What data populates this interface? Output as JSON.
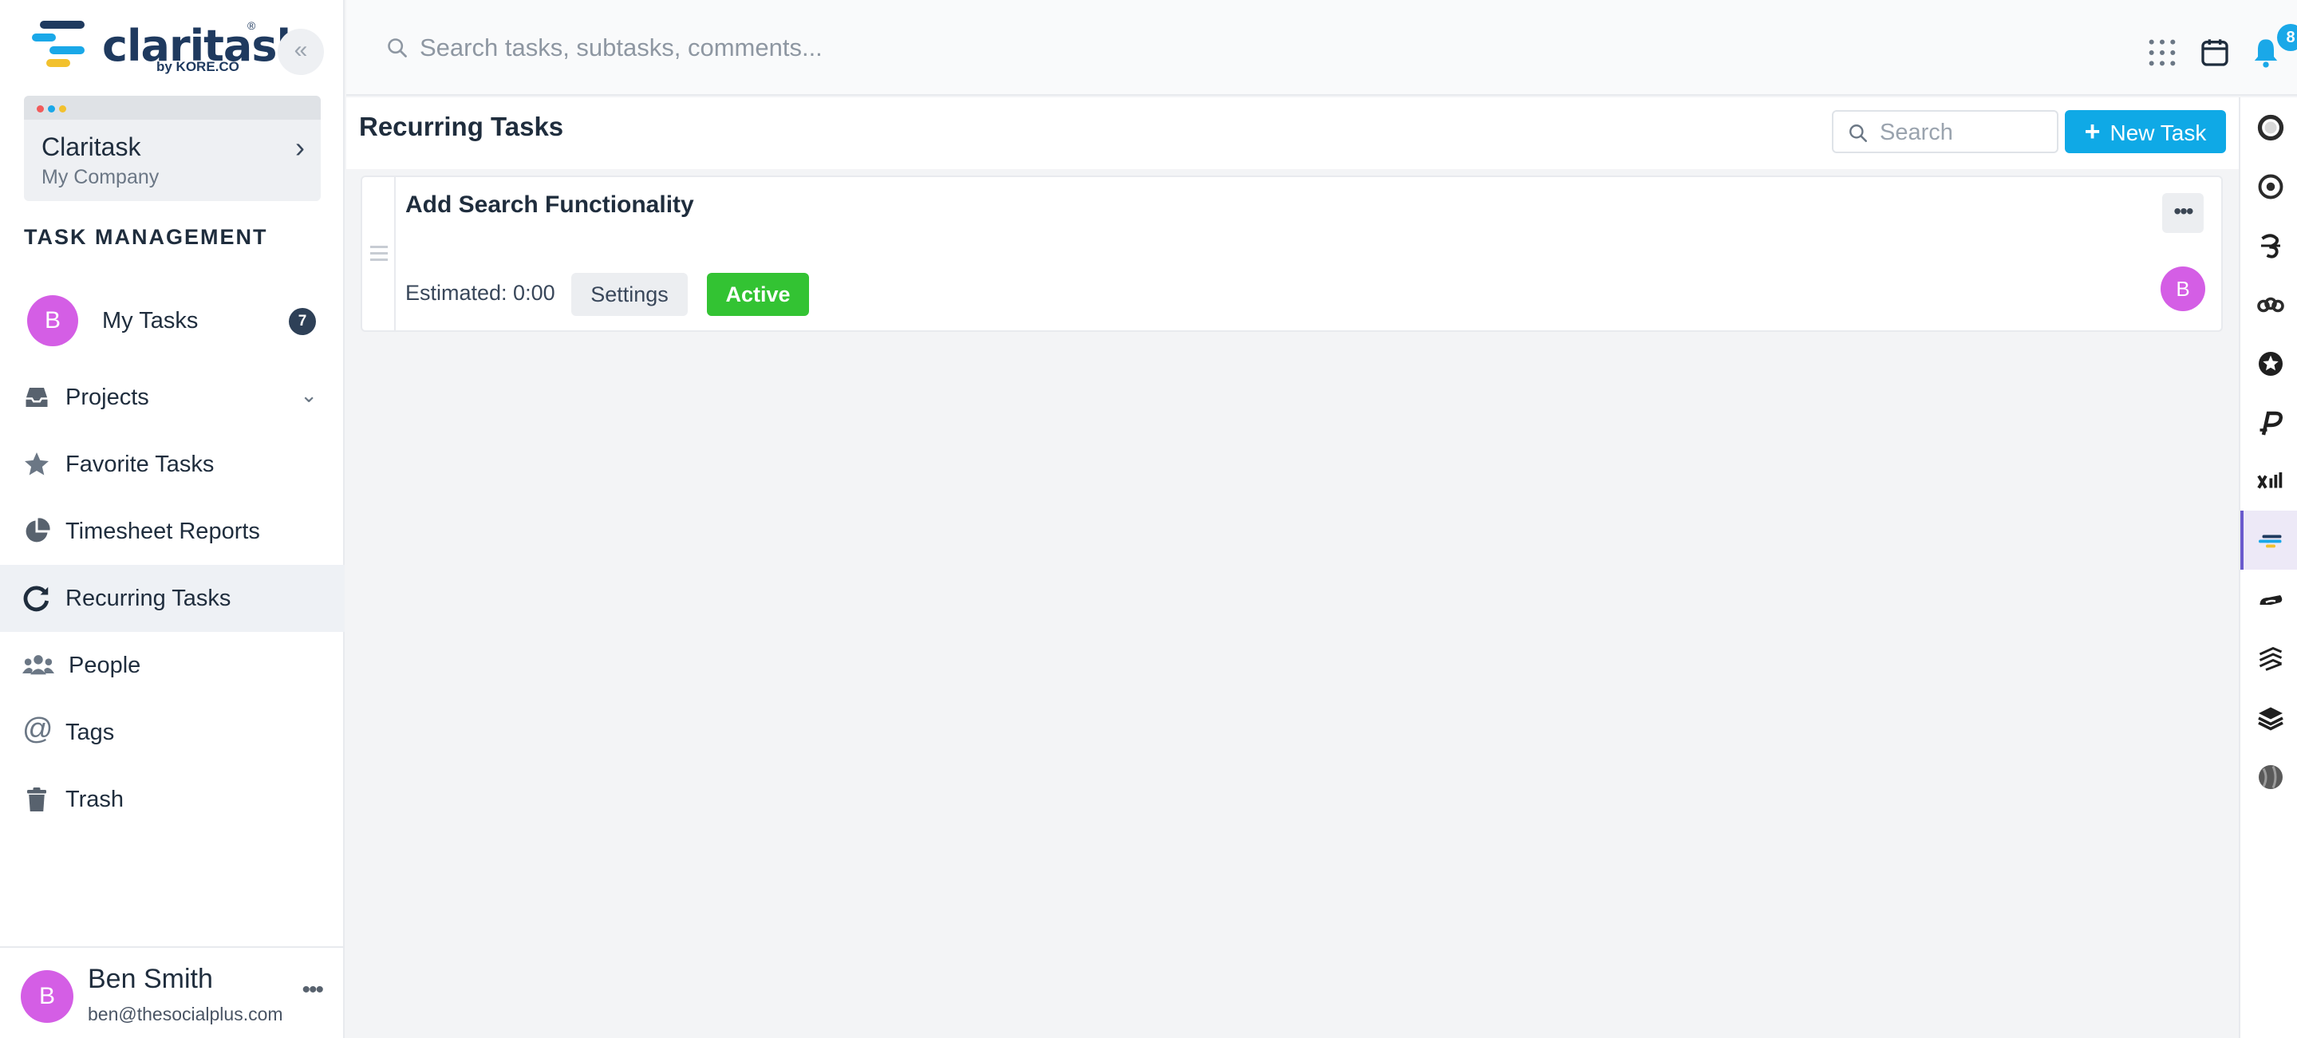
{
  "brand": {
    "name": "claritask",
    "by_line": "by KORE.CO",
    "registered_mark": "®",
    "colors": {
      "dark": "#1f3a5f",
      "blue": "#1aa8e8",
      "yellow": "#f2c12e",
      "green": "#33c333",
      "avatar": "#d45ee5"
    }
  },
  "sidebar": {
    "collapse_icon": "double-chevron-left-icon",
    "company": {
      "name": "Claritask",
      "subtitle": "My Company"
    },
    "section_title": "TASK MANAGEMENT",
    "items": [
      {
        "label": "My Tasks",
        "icon": "avatar",
        "avatar_initial": "B",
        "count": "7"
      },
      {
        "label": "Projects",
        "icon": "inbox-icon",
        "has_chevron": true
      },
      {
        "label": "Favorite Tasks",
        "icon": "star-icon"
      },
      {
        "label": "Timesheet Reports",
        "icon": "pie-chart-icon"
      },
      {
        "label": "Recurring Tasks",
        "icon": "refresh-icon",
        "active": true
      },
      {
        "label": "People",
        "icon": "users-icon"
      },
      {
        "label": "Tags",
        "icon": "at-sign-icon"
      },
      {
        "label": "Trash",
        "icon": "trash-icon"
      }
    ],
    "user": {
      "initial": "B",
      "name": "Ben Smith",
      "email": "ben@thesocialplus.com",
      "more": "•••"
    }
  },
  "topbar": {
    "search_placeholder": "Search tasks, subtasks, comments...",
    "icons": [
      "apps-grid-icon",
      "calendar-icon",
      "bell-icon"
    ],
    "notification_count": "8"
  },
  "content": {
    "title": "Recurring Tasks",
    "search_placeholder": "Search",
    "new_task_label": "New Task",
    "new_task_plus": "+"
  },
  "tasks": [
    {
      "title": "Add Search Functionality",
      "estimated": "Estimated: 0:00",
      "settings_label": "Settings",
      "status": "Active",
      "assignee_initial": "B",
      "more": "•••"
    }
  ],
  "app_rail": {
    "items": [
      "ring-app-icon",
      "target-app-icon",
      "script-app-icon",
      "chain-app-icon",
      "star-badge-app-icon",
      "p-app-icon",
      "bars-app-icon",
      "claritask-app-icon",
      "cloud-app-icon",
      "layers-app-icon",
      "stack-app-icon",
      "globe-app-icon"
    ],
    "active_index": 7
  }
}
